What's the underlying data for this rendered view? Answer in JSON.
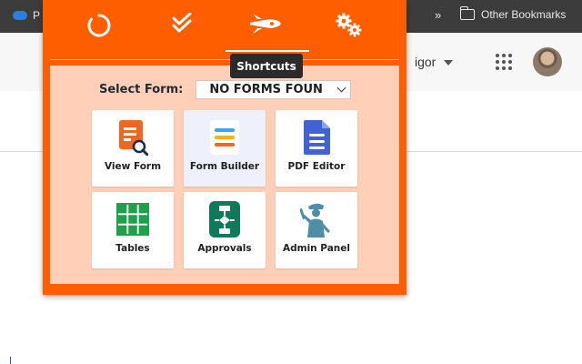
{
  "browser": {
    "bookmark_left_label": "P",
    "more_chevron": "»",
    "other_bookmarks": "Other Bookmarks",
    "user_name": "igor"
  },
  "popup": {
    "tabs": [
      {
        "name": "refresh",
        "icon": "refresh-icon"
      },
      {
        "name": "checks",
        "icon": "double-check-icon"
      },
      {
        "name": "shortcuts",
        "icon": "rocket-icon",
        "active": true
      },
      {
        "name": "settings",
        "icon": "gears-icon"
      }
    ],
    "tooltip": "Shortcuts",
    "select_label": "Select Form:",
    "select_value": "NO FORMS FOUN",
    "cards": [
      {
        "label": "View Form",
        "icon": "view-form-icon"
      },
      {
        "label": "Form Builder",
        "icon": "form-builder-icon"
      },
      {
        "label": "PDF Editor",
        "icon": "pdf-editor-icon"
      },
      {
        "label": "Tables",
        "icon": "tables-icon"
      },
      {
        "label": "Approvals",
        "icon": "approvals-icon"
      },
      {
        "label": "Admin Panel",
        "icon": "admin-panel-icon"
      }
    ]
  },
  "colors": {
    "accent": "#ff5e00",
    "panel": "#ffcfb7",
    "view_form": "#f26522",
    "pdf_editor": "#3f63d0",
    "tables": "#1fa04a",
    "approvals": "#0e7a5c",
    "admin_panel": "#4e8fa8"
  }
}
